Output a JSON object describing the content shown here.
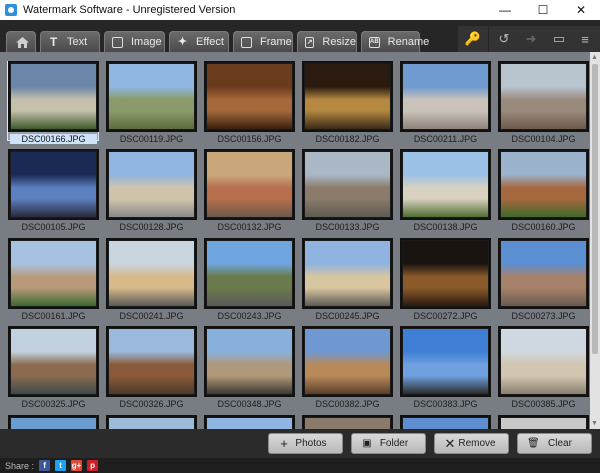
{
  "window": {
    "title": "Watermark Software - Unregistered Version",
    "min": "—",
    "max": "☐",
    "close": "✕"
  },
  "tabs": [
    {
      "label": "Text",
      "icon": "text-icon"
    },
    {
      "label": "Image",
      "icon": "image-icon"
    },
    {
      "label": "Effect",
      "icon": "effect-icon"
    },
    {
      "label": "Frame",
      "icon": "frame-icon"
    },
    {
      "label": "Resize",
      "icon": "resize-icon"
    },
    {
      "label": "Rename",
      "icon": "rename-icon"
    }
  ],
  "thumbnails": [
    {
      "file": "DSC00166.JPG",
      "selected": true,
      "colors": [
        "#6a86a8",
        "#c5c0aa",
        "#3e5a2a"
      ]
    },
    {
      "file": "DSC00119.JPG",
      "selected": false,
      "colors": [
        "#8fb7e1",
        "#8a9a6a",
        "#5c6b3c"
      ]
    },
    {
      "file": "DSC00156.JPG",
      "selected": false,
      "colors": [
        "#6b3b1e",
        "#a4683a",
        "#3a200e"
      ]
    },
    {
      "file": "DSC00182.JPG",
      "selected": false,
      "colors": [
        "#2a1a10",
        "#b48840",
        "#3a2a18"
      ]
    },
    {
      "file": "DSC00211.JPG",
      "selected": false,
      "colors": [
        "#6f9bd0",
        "#c9c3b9",
        "#8d8379"
      ]
    },
    {
      "file": "DSC00104.JPG",
      "selected": false,
      "colors": [
        "#b8c4ce",
        "#9a8a7c",
        "#6e5a4c"
      ]
    },
    {
      "file": "DSC00105.JPG",
      "selected": false,
      "colors": [
        "#1a2a55",
        "#5c7fc0",
        "#2a2a3a"
      ]
    },
    {
      "file": "DSC00128.JPG",
      "selected": false,
      "colors": [
        "#8fb5e0",
        "#cfc4ab",
        "#8a8a8a"
      ]
    },
    {
      "file": "DSC00132.JPG",
      "selected": false,
      "colors": [
        "#c9a77a",
        "#b76f4e",
        "#6a5a4a"
      ]
    },
    {
      "file": "DSC00133.JPG",
      "selected": false,
      "colors": [
        "#aab8c6",
        "#8b7b6a",
        "#5d5a52"
      ]
    },
    {
      "file": "DSC00138.JPG",
      "selected": false,
      "colors": [
        "#9cc1e6",
        "#d8d1c0",
        "#4f6e30"
      ]
    },
    {
      "file": "DSC00160.JPG",
      "selected": false,
      "colors": [
        "#9ab2cc",
        "#a6683f",
        "#3e6a2a"
      ]
    },
    {
      "file": "DSC00161.JPG",
      "selected": false,
      "colors": [
        "#a7c2e0",
        "#b89a7a",
        "#3a6a30"
      ]
    },
    {
      "file": "DSC00241.JPG",
      "selected": false,
      "colors": [
        "#c8d4de",
        "#d7b98a",
        "#5a5a5a"
      ]
    },
    {
      "file": "DSC00243.JPG",
      "selected": false,
      "colors": [
        "#6fa5df",
        "#6a7a4a",
        "#5a5a5a"
      ]
    },
    {
      "file": "DSC00245.JPG",
      "selected": false,
      "colors": [
        "#8fb4df",
        "#d7c6a0",
        "#5e5a54"
      ]
    },
    {
      "file": "DSC00272.JPG",
      "selected": false,
      "colors": [
        "#1a1410",
        "#8a5a2a",
        "#2a1a10"
      ]
    },
    {
      "file": "DSC00273.JPG",
      "selected": false,
      "colors": [
        "#5b8fd2",
        "#a7826a",
        "#6a5a50"
      ]
    },
    {
      "file": "DSC00325.JPG",
      "selected": false,
      "colors": [
        "#c2d1e0",
        "#8c6a50",
        "#3a4a4a"
      ]
    },
    {
      "file": "DSC00326.JPG",
      "selected": false,
      "colors": [
        "#9ab9dc",
        "#8a5a3a",
        "#4a3a2a"
      ]
    },
    {
      "file": "DSC00348.JPG",
      "selected": false,
      "colors": [
        "#88b0dc",
        "#b0987a",
        "#3a3a30"
      ]
    },
    {
      "file": "DSC00382.JPG",
      "selected": false,
      "colors": [
        "#6f98d2",
        "#b88a5a",
        "#5a3e28"
      ]
    },
    {
      "file": "DSC00383.JPG",
      "selected": false,
      "colors": [
        "#3f7fd6",
        "#6fa0e0",
        "#2a2a2a"
      ]
    },
    {
      "file": "DSC00385.JPG",
      "selected": false,
      "colors": [
        "#cfd8e0",
        "#d2c6b0",
        "#8a8070"
      ]
    },
    {
      "file": "",
      "selected": false,
      "colors": [
        "#6b9ccf",
        "#6b9ccf",
        "#6b9ccf"
      ]
    },
    {
      "file": "",
      "selected": false,
      "colors": [
        "#9dbad8",
        "#9dbad8",
        "#9dbad8"
      ]
    },
    {
      "file": "",
      "selected": false,
      "colors": [
        "#8fb5e0",
        "#8fb5e0",
        "#8fb5e0"
      ]
    },
    {
      "file": "",
      "selected": false,
      "colors": [
        "#8a7a6a",
        "#8a7a6a",
        "#8a7a6a"
      ]
    },
    {
      "file": "",
      "selected": false,
      "colors": [
        "#5f8fd0",
        "#5f8fd0",
        "#5f8fd0"
      ]
    },
    {
      "file": "",
      "selected": false,
      "colors": [
        "#c9c9c9",
        "#c9c9c9",
        "#c9c9c9"
      ]
    }
  ],
  "actions": {
    "photos": "Photos",
    "folder": "Folder",
    "remove": "Remove",
    "clear": "Clear"
  },
  "share": {
    "label": "Share :",
    "networks": [
      {
        "name": "facebook",
        "glyph": "f",
        "color": "#3b5998"
      },
      {
        "name": "twitter",
        "glyph": "t",
        "color": "#1da1f2"
      },
      {
        "name": "google-plus",
        "glyph": "g+",
        "color": "#dd4b39"
      },
      {
        "name": "pinterest",
        "glyph": "p",
        "color": "#cb2027"
      }
    ]
  }
}
